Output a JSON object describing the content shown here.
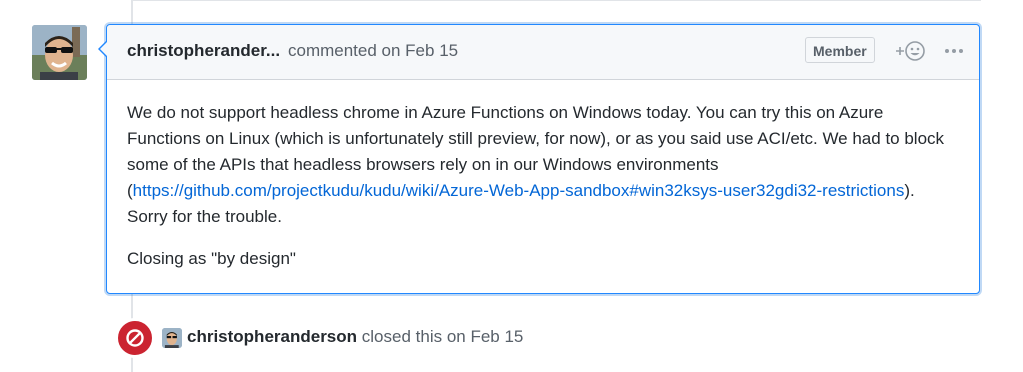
{
  "comment": {
    "author": "christopherander...",
    "meta": "commented on Feb 15",
    "badge": "Member",
    "body": {
      "p1_text_before": "We do not support headless chrome in Azure Functions on Windows today. You can try this on Azure Functions on Linux (which is unfortunately still preview, for now), or as you said use ACI/etc. We had to block some of the APIs that headless browsers rely on in our Windows environments (",
      "p1_link": "https://github.com/projectkudu/kudu/wiki/Azure-Web-App-sandbox#win32ksys-user32gdi32-restrictions",
      "p1_text_after": "). Sorry for the trouble.",
      "p2": "Closing as \"by design\""
    }
  },
  "event": {
    "author": "christopheranderson",
    "action": "closed this on Feb 15"
  },
  "colors": {
    "link": "#0366d6",
    "closed_badge": "#cb2431",
    "focus_border": "#2188ff"
  },
  "icons": {
    "reaction": "smiley-plus-icon",
    "more": "kebab-horizontal-icon",
    "closed": "circle-slash-icon"
  }
}
